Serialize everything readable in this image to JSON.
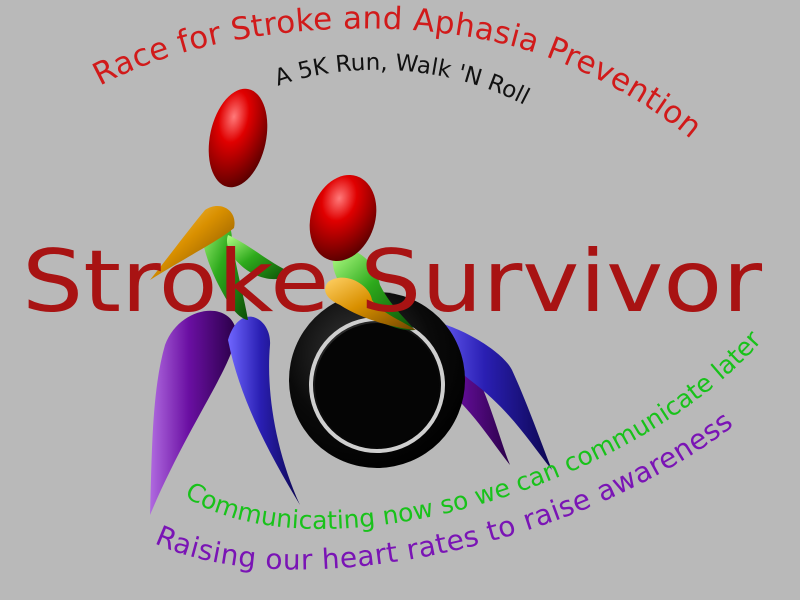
{
  "logo": {
    "title_arc": "Race for Stroke and Aphasia Prevention",
    "subtitle_arc": "A 5K Run, Walk 'N Roll",
    "main_title": "Stroke Survivor",
    "green_arc": "Communicating now so we can communicate later",
    "purple_arc": "Raising our heart rates to raise awareness"
  },
  "colors": {
    "background": "#b9b9b9",
    "title_red": "#d11a1a",
    "main_red": "#a81313",
    "subtitle_black": "#111111",
    "green": "#18c21a",
    "purple": "#7a14b5",
    "figure_red": "#c40000",
    "figure_orange": "#d99000",
    "figure_green": "#2eaa1c",
    "figure_purple": "#6a0fa2",
    "figure_blue": "#2a1fb3",
    "wheel_black": "#050505"
  }
}
